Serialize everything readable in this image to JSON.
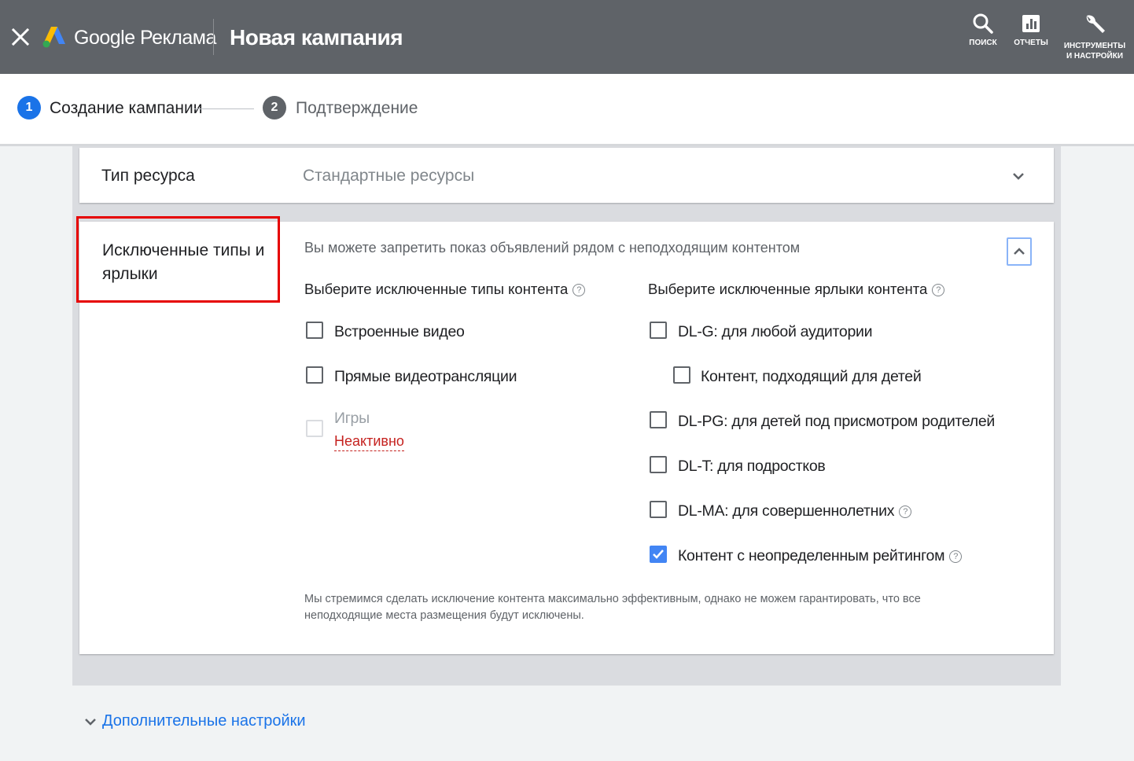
{
  "header": {
    "brand": "Google Реклама",
    "title": "Новая кампания",
    "tools": [
      {
        "label": "ПОИСК",
        "icon": "search-icon"
      },
      {
        "label": "ОТЧЕТЫ",
        "icon": "reports-icon"
      },
      {
        "label_line1": "ИНСТРУМЕНТЫ",
        "label_line2": "И НАСТРОЙКИ",
        "icon": "wrench-icon"
      }
    ]
  },
  "stepper": {
    "steps": [
      {
        "number": "1",
        "label": "Создание кампании",
        "active": true
      },
      {
        "number": "2",
        "label": "Подтверждение",
        "active": false
      }
    ]
  },
  "resource": {
    "label": "Тип ресурса",
    "value": "Стандартные ресурсы"
  },
  "exclusions": {
    "label": "Исключенные типы и ярлыки",
    "intro": "Вы можете запретить показ объявлений рядом с неподходящим контентом",
    "left_heading": "Выберите исключенные типы контента",
    "right_heading": "Выберите исключенные ярлыки контента",
    "content_types": [
      {
        "label": "Встроенные видео",
        "checked": false
      },
      {
        "label": "Прямые видеотрансляции",
        "checked": false
      },
      {
        "label": "Игры",
        "checked": false,
        "disabled": true,
        "status": "Неактивно"
      }
    ],
    "content_labels": [
      {
        "label": "DL-G: для любой аудитории",
        "checked": false
      },
      {
        "label": "Контент, подходящий для детей",
        "checked": false
      },
      {
        "label": "DL-PG: для детей под присмотром родителей",
        "checked": false
      },
      {
        "label": "DL-T: для подростков",
        "checked": false
      },
      {
        "label": "DL-MA: для совершеннолетних",
        "checked": false
      },
      {
        "label": "Контент с неопределенным рейтингом",
        "checked": true
      }
    ],
    "disclaimer": "Мы стремимся сделать исключение контента максимально эффективным, однако не можем гарантировать, что все неподходящие места размещения будут исключены."
  },
  "advanced_settings": "Дополнительные настройки",
  "colors": {
    "topbar": "#5f6368",
    "accent": "#1a73e8",
    "highlight": "#e60000",
    "inactive": "#c5221f"
  }
}
